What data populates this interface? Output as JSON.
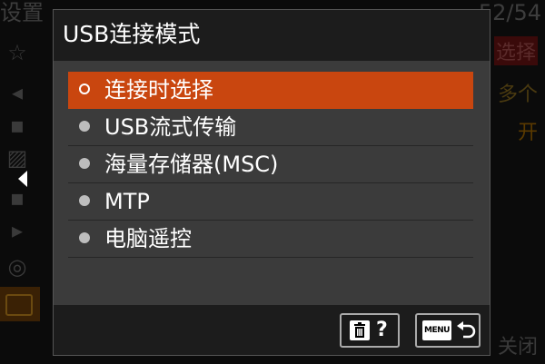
{
  "background": {
    "title_left": "设置",
    "title_right": "52/54",
    "right_items": [
      "选择",
      "多个",
      "开",
      "关闭"
    ],
    "accent_color": "#c9460f"
  },
  "dialog": {
    "title": "USB连接模式",
    "options": [
      {
        "label": "连接时选择",
        "selected": true
      },
      {
        "label": "USB流式传输",
        "selected": false
      },
      {
        "label": "海量存储器(MSC)",
        "selected": false
      },
      {
        "label": "MTP",
        "selected": false
      },
      {
        "label": "电脑遥控",
        "selected": false
      }
    ],
    "footer": {
      "delete_help_label": "?",
      "menu_key_label": "MENU"
    }
  }
}
